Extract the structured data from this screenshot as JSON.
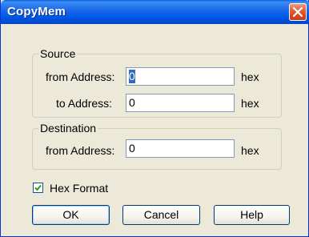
{
  "window": {
    "title": "CopyMem",
    "close_icon": "close-icon"
  },
  "source": {
    "legend": "Source",
    "from_label": "from Address:",
    "from_value": "0",
    "from_unit": "hex",
    "to_label": "to Address:",
    "to_value": "0",
    "to_unit": "hex"
  },
  "destination": {
    "legend": "Destination",
    "from_label": "from Address:",
    "from_value": "0",
    "from_unit": "hex"
  },
  "options": {
    "hex_format_label": "Hex Format",
    "hex_format_checked": true
  },
  "buttons": {
    "ok": "OK",
    "cancel": "Cancel",
    "help": "Help"
  },
  "colors": {
    "titlebar": "#0058e6",
    "close": "#e35a31",
    "dialog_bg": "#ece9d8",
    "input_border": "#7f9db9",
    "selection": "#316ac5"
  }
}
